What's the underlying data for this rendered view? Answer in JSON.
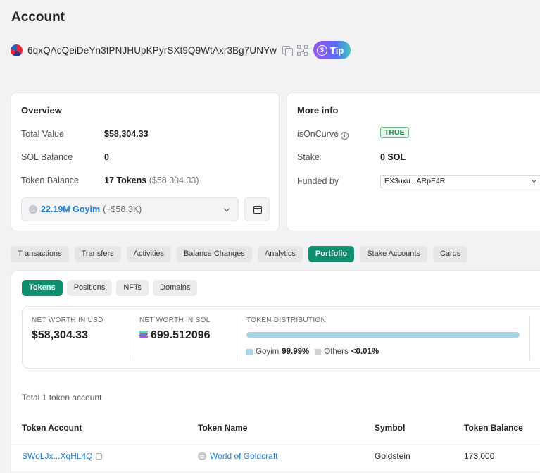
{
  "page": {
    "title": "Account"
  },
  "account": {
    "address": "6qxQAcQeiDeYn3fPNJHUpKPyrSXt9Q9WtAxr3Bg7UNYw",
    "tip_label": "Tip",
    "tip_icon_glyph": "$"
  },
  "overview": {
    "title": "Overview",
    "total_value_label": "Total Value",
    "total_value": "$58,304.33",
    "sol_balance_label": "SOL Balance",
    "sol_balance": "0",
    "token_balance_label": "Token Balance",
    "token_balance": "17 Tokens",
    "token_balance_usd": "($58,304.33)",
    "selected_token_amount": "22.19M Goyim",
    "selected_token_usd": "(~$58.3K)"
  },
  "more_info": {
    "title": "More info",
    "is_on_curve_label": "isOnCurve",
    "is_on_curve_value": "TRUE",
    "stake_label": "Stake",
    "stake_value": "0 SOL",
    "funded_by_label": "Funded by",
    "funded_by_value": "EX3uxu...ARpE4R"
  },
  "tabs": [
    "Transactions",
    "Transfers",
    "Activities",
    "Balance Changes",
    "Analytics",
    "Portfolio",
    "Stake Accounts",
    "Cards"
  ],
  "active_tab": "Portfolio",
  "subtabs": [
    "Tokens",
    "Positions",
    "NFTs",
    "Domains"
  ],
  "active_subtab": "Tokens",
  "net_worth": {
    "usd_label": "NET WORTH IN USD",
    "usd_value": "$58,304.33",
    "sol_label": "NET WORTH IN SOL",
    "sol_value": "699.512096",
    "distribution_label": "TOKEN DISTRIBUTION",
    "distribution": [
      {
        "name": "Goyim",
        "pct": "99.99%",
        "fraction": 0.9999,
        "color": "#a8d4ea"
      },
      {
        "name": "Others",
        "pct": "<0.01%",
        "fraction": 0.0001,
        "color": "#cfd1d6"
      }
    ]
  },
  "token_accounts": {
    "total_text": "Total 1 token account",
    "headers": [
      "Token Account",
      "Token Name",
      "Symbol",
      "Token Balance"
    ],
    "rows": [
      {
        "account": "SWoLJx...XqHL4Q",
        "name": "World of Goldcraft",
        "symbol": "Goldstein",
        "balance": "173,000"
      }
    ]
  },
  "colors": {
    "accent": "#0f8f6f",
    "link": "#1f7ad6",
    "badge_green": "#1f8a4a"
  }
}
